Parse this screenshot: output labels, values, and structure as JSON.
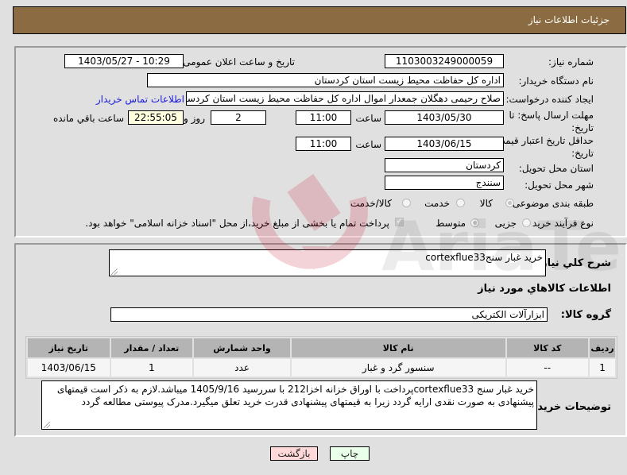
{
  "header": {
    "title": "جزئیات اطلاعات نیاز"
  },
  "fields": {
    "need_number": {
      "label": "شماره نیاز:",
      "value": "1103003249000059"
    },
    "announce_datetime": {
      "label": "تاریخ و ساعت اعلان عمومی:",
      "value": "1403/05/27 - 10:29"
    },
    "buyer_org": {
      "label": "نام دستگاه خریدار:",
      "value": "اداره کل حفاظت محیط زیست استان کردستان"
    },
    "requester": {
      "label": "ایجاد کننده درخواست:",
      "value": "صلاح  رحیمی دهگلان جمعدار اموال اداره کل حفاظت محیط زیست استان کردستان",
      "contact_link": "اطلاعات تماس خریدار"
    },
    "reply_deadline": {
      "label": "مهلت ارسال پاسخ: تا تاریخ:",
      "date": "1403/05/30",
      "time_label": "ساعت",
      "time": "11:00",
      "days": "2",
      "days_label": "روز و",
      "remaining_time": "22:55:05",
      "remaining_label": "ساعت باقي مانده"
    },
    "price_validity": {
      "label": "حداقل تاریخ اعتبار قیمت: تا تاریخ:",
      "date": "1403/06/15",
      "time_label": "ساعت",
      "time": "11:00"
    },
    "delivery_province": {
      "label": "استان محل تحویل:",
      "value": "کردستان"
    },
    "delivery_city": {
      "label": "شهر محل تحویل:",
      "value": "سنندج"
    },
    "category": {
      "label": "طبقه بندی موضوعی:",
      "options": [
        "کالا",
        "خدمت",
        "کالا/خدمت"
      ],
      "selected": "کالا"
    },
    "purchase_type": {
      "label": "نوع فرآیند خرید :",
      "options": [
        "جزیی",
        "متوسط"
      ],
      "selected": "متوسط",
      "treasury_note": "پرداخت تمام یا بخشی از مبلغ خرید،از محل \"اسناد خزانه اسلامی\" خواهد بود.",
      "treasury_checked": true
    }
  },
  "description": {
    "label": "شرح کلي نياز:",
    "value": "خرید غبار سنجcortexflue33"
  },
  "goods_section": {
    "title": "اطلاعات کالاهاي مورد نياز",
    "group_label": "گروه کالا:",
    "group_value": "ابزارآلات الکتریکی",
    "table": {
      "columns": [
        "رديف",
        "کد کالا",
        "نام کالا",
        "واحد شمارش",
        "تعداد / مقدار",
        "تاریخ نیاز"
      ],
      "rows": [
        [
          "1",
          "--",
          "سنسور گرد و غبار",
          "عدد",
          "1",
          "1403/06/15"
        ]
      ]
    }
  },
  "buyer_notes": {
    "label": "توضیحات خریدار:",
    "value": "خرید غبار سنج cortexflue33پرداخت با اوراق خزانه اخزا212 با سررسید 1405/9/16 میباشد.لازم به ذکر است قیمتهای پیشنهادی به صورت نقدی ارایه گردد زیرا به قیمتهای پیشنهادی قدرت خرید تعلق میگیرد.مدرک پیوستی مطالعه گردد"
  },
  "buttons": {
    "print": "چاپ",
    "back": "بازگشت"
  },
  "watermark": {
    "text": "AriaTender.neT"
  }
}
